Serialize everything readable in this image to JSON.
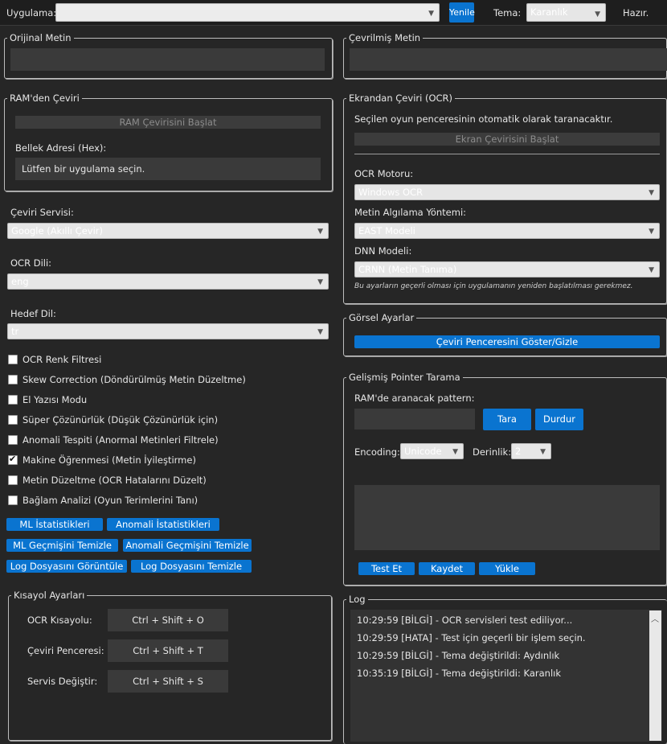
{
  "topbar": {
    "app_label": "Uygulama:",
    "app_value": "",
    "refresh_label": "Yenile",
    "theme_label": "Tema:",
    "theme_value": "Karanlık",
    "status": "Hazır."
  },
  "original": {
    "title": "Orijinal Metin",
    "value": ""
  },
  "translated": {
    "title": "Çevrilmiş Metin",
    "value": ""
  },
  "ram": {
    "title": "RAM'den Çeviri",
    "start_label": "RAM Çevirisini Başlat",
    "address_label": "Bellek Adresi (Hex):",
    "address_value": "Lütfen bir uygulama seçin."
  },
  "settings": {
    "service_label": "Çeviri Servisi:",
    "service_value": "Google (Akıllı Çevir)",
    "ocr_lang_label": "OCR Dili:",
    "ocr_lang_value": "eng",
    "target_lang_label": "Hedef Dil:",
    "target_lang_value": "tr"
  },
  "options": [
    {
      "label": "OCR Renk Filtresi",
      "checked": false
    },
    {
      "label": "Skew Correction (Döndürülmüş Metin Düzeltme)",
      "checked": false
    },
    {
      "label": "El Yazısı Modu",
      "checked": false
    },
    {
      "label": "Süper Çözünürlük (Düşük Çözünürlük için)",
      "checked": false
    },
    {
      "label": "Anomali Tespiti (Anormal Metinleri Filtrele)",
      "checked": false
    },
    {
      "label": "Makine Öğrenmesi (Metin İyileştirme)",
      "checked": true
    },
    {
      "label": "Metin Düzeltme (OCR Hatalarını Düzelt)",
      "checked": false
    },
    {
      "label": "Bağlam Analizi (Oyun Terimlerini Tanı)",
      "checked": false
    }
  ],
  "tools": {
    "ml_stats": "ML İstatistikleri",
    "anomaly_stats": "Anomali İstatistikleri",
    "ml_clear": "ML Geçmişini Temizle",
    "anomaly_clear": "Anomali Geçmişini Temizle",
    "log_view": "Log Dosyasını Görüntüle",
    "log_clear": "Log Dosyasını Temizle"
  },
  "shortcuts": {
    "title": "Kısayol Ayarları",
    "items": [
      {
        "label": "OCR Kısayolu:",
        "keys": "Ctrl + Shift + O"
      },
      {
        "label": "Çeviri Penceresi:",
        "keys": "Ctrl + Shift + T"
      },
      {
        "label": "Servis Değiştir:",
        "keys": "Ctrl + Shift + S"
      }
    ]
  },
  "ocr": {
    "title": "Ekrandan Çeviri (OCR)",
    "description": "Seçilen oyun penceresinin otomatik olarak taranacaktır.",
    "start_label": "Ekran Çevirisini Başlat",
    "engine_label": "OCR Motoru:",
    "engine_value": "Windows OCR",
    "detect_label": "Metin Algılama Yöntemi:",
    "detect_value": "EAST Modeli",
    "dnn_label": "DNN Modeli:",
    "dnn_value": "CRNN (Metin Tanıma)",
    "note": "Bu ayarların geçerli olması için uygulamanın yeniden başlatılması gerekmez."
  },
  "visual": {
    "title": "Görsel Ayarlar",
    "toggle_label": "Çeviri Penceresini Göster/Gizle"
  },
  "pointer": {
    "title": "Gelişmiş Pointer Tarama",
    "pattern_label": "RAM'de aranacak pattern:",
    "pattern_value": "",
    "scan_label": "Tara",
    "stop_label": "Durdur",
    "encoding_label": "Encoding:",
    "encoding_value": "Unicode",
    "depth_label": "Derinlik:",
    "depth_value": "2",
    "test_label": "Test Et",
    "save_label": "Kaydet",
    "load_label": "Yükle"
  },
  "log": {
    "title": "Log",
    "lines": [
      "10:29:59 [BİLGİ] - OCR servisleri test ediliyor...",
      "10:29:59 [HATA] - Test için geçerli bir işlem seçin.",
      "10:29:59 [BİLGİ] - Tema değiştirildi: Aydınlık",
      "10:35:19 [BİLGİ] - Tema değiştirildi: Karanlık"
    ]
  },
  "colors": {
    "accent": "#0a74d0",
    "background": "#262626",
    "field": "#3a3a3a"
  }
}
